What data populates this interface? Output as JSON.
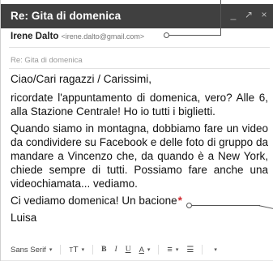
{
  "window": {
    "title": "Re: Gita di domenica",
    "controls": {
      "minimize": "_",
      "expand": "↗",
      "close": "×"
    }
  },
  "header": {
    "sender_name": "Irene Dalto",
    "sender_email": "<irene.dalto@gmail.com>",
    "subject": "Re: Gita di domenica"
  },
  "message": {
    "greeting": "Ciao/Cari ragazzi / Carissimi,",
    "para1": "ricordate l'appuntamento di domenica, vero? Alle 6, alla Stazione Centrale! Ho io tutti i biglietti.",
    "para2": "Quando siamo in montagna, dobbiamo fare un video da condividere su Facebook e delle foto di gruppo da mandare a Vincenzo che, da quando è a New York, chiede sempre di tutti. Possiamo fare anche una videochiamata... vediamo.",
    "closing": "Ci vediamo domenica! Un bacione",
    "closing_mark": "*",
    "signature": "Luisa"
  },
  "toolbar": {
    "font": "Sans Serif",
    "size_icon": "T",
    "bold": "B",
    "italic": "I",
    "underline": "U",
    "text_color": "A",
    "align_icon": "≡",
    "list_icon": "☰",
    "more_arrow": "▾"
  }
}
